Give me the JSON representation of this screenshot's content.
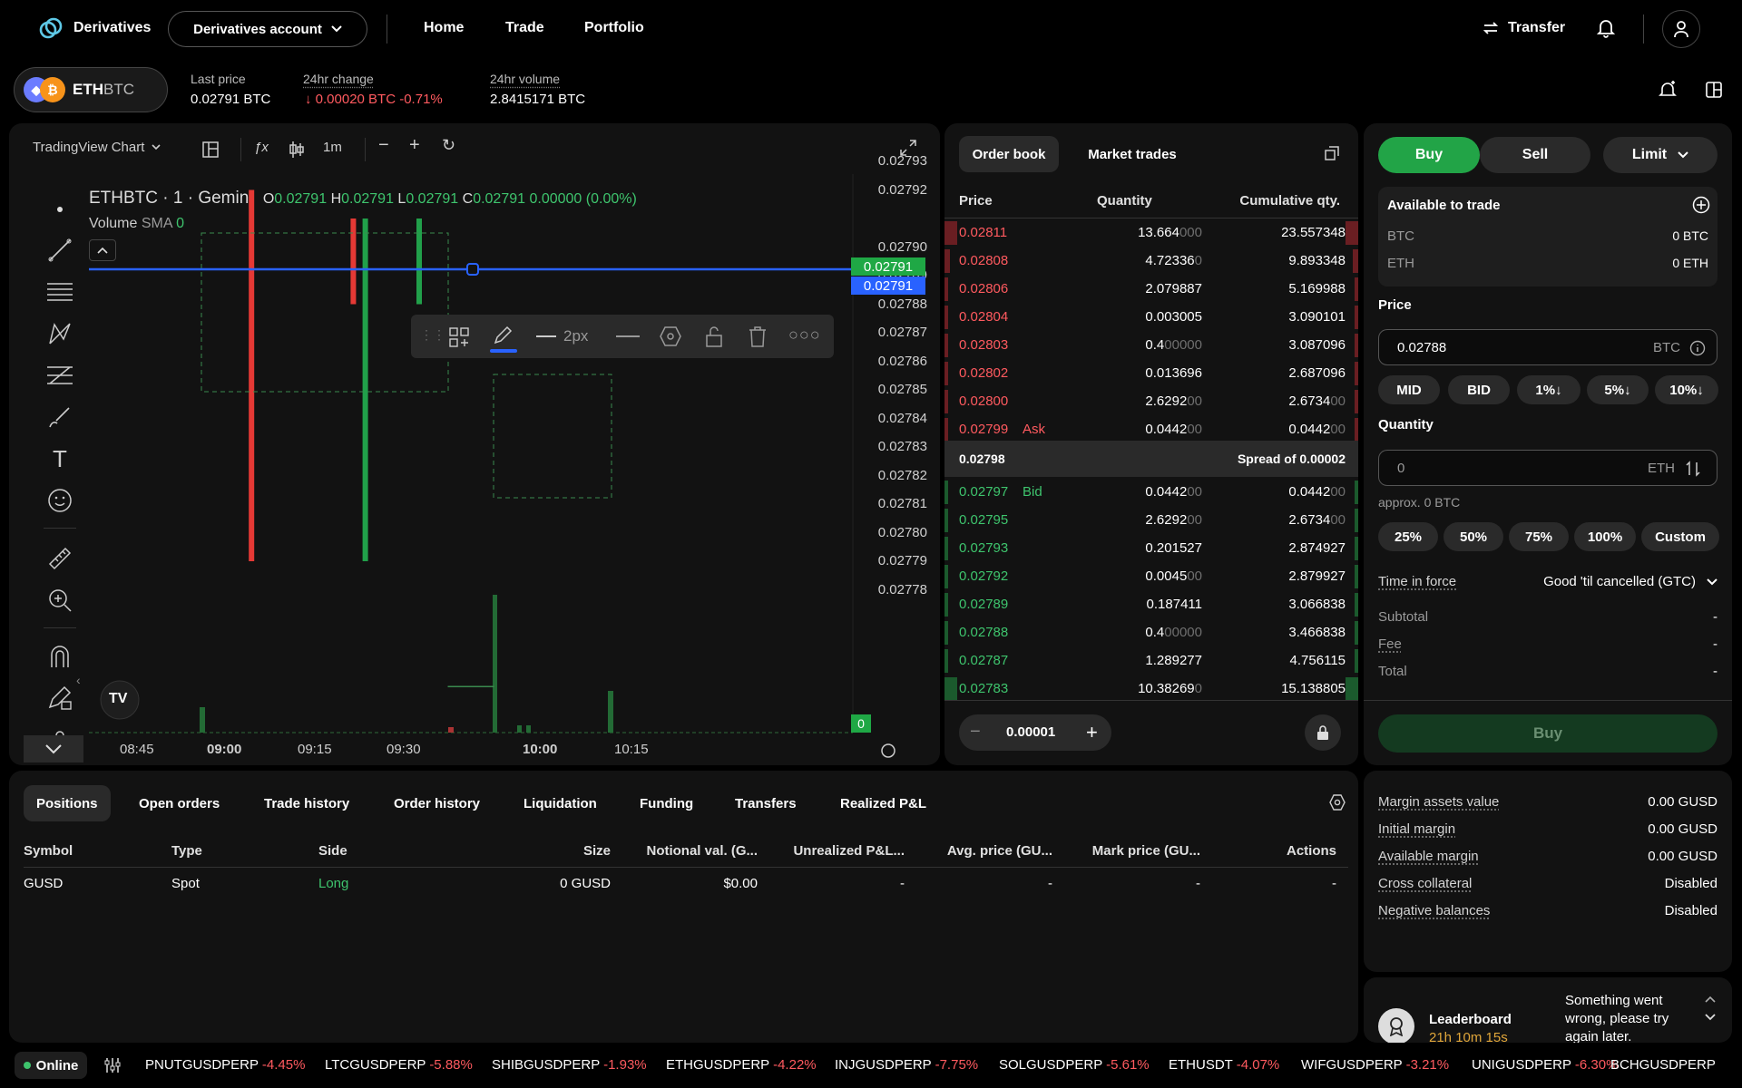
{
  "colors": {
    "accent_green": "#22a447",
    "red": "#ff5a5f",
    "blue": "#2962ff",
    "panel": "#121212"
  },
  "nav": {
    "brand": "Derivatives",
    "account_label": "Derivatives account",
    "links": [
      "Home",
      "Trade",
      "Portfolio"
    ],
    "transfer_label": "Transfer"
  },
  "market": {
    "pair_base": "ETH",
    "pair_quote": "BTC",
    "last_price_label": "Last price",
    "last_price": "0.02791 BTC",
    "change_label": "24hr change",
    "change_value": "↓ 0.00020 BTC -0.71%",
    "volume_label": "24hr volume",
    "volume_value": "2.8415171 BTC"
  },
  "chart": {
    "toolbar_label": "TradingView Chart",
    "interval": "1m",
    "legend_symbol": "ETHBTC · 1 · Gemini",
    "ohlc": {
      "o_label": "O",
      "o": "0.02791",
      "h_label": "H",
      "h": "0.02791",
      "l_label": "L",
      "l": "0.02791",
      "c_label": "C",
      "c": "0.02791",
      "change": "0.00000 (0.00%)"
    },
    "volume_label": "Volume",
    "sma_label": "SMA",
    "sma_value": "0",
    "line_width_label": "2px",
    "price_ticks": [
      "0.02793",
      "0.02792",
      "0.02790",
      "0.02789",
      "0.02788",
      "0.02787",
      "0.02786",
      "0.02785",
      "0.02784",
      "0.02783",
      "0.02782",
      "0.02781",
      "0.02780",
      "0.02779",
      "0.02778"
    ],
    "current_price_tag": "0.02791",
    "line_price_tag": "0.02791",
    "volume_tag": "0",
    "time_ticks": [
      "08:45",
      "09:00",
      "09:15",
      "09:30",
      "10:00",
      "10:15"
    ],
    "tv_logo": "TV"
  },
  "chart_data": {
    "type": "candlestick",
    "ylim": [
      0.02778,
      0.02793
    ],
    "candles": [
      {
        "t": "09:07",
        "o": 0.02792,
        "h": 0.02792,
        "l": 0.02779,
        "c": 0.02779,
        "dir": "down"
      },
      {
        "t": "09:24",
        "o": 0.02791,
        "h": 0.02791,
        "l": 0.02788,
        "c": 0.02788,
        "dir": "down"
      },
      {
        "t": "09:26",
        "o": 0.02779,
        "h": 0.02791,
        "l": 0.02779,
        "c": 0.02791,
        "dir": "up"
      },
      {
        "t": "09:35",
        "o": 0.02788,
        "h": 0.02792,
        "l": 0.02788,
        "c": 0.02791,
        "dir": "up"
      }
    ]
  },
  "orderbook": {
    "tab_book": "Order book",
    "tab_trades": "Market trades",
    "headers": [
      "Price",
      "Quantity",
      "Cumulative qty."
    ],
    "asks": [
      {
        "price": "0.02811",
        "qty": "13.664",
        "qty_dim": "000",
        "cum": "23.557348",
        "cum_dim": "",
        "depth": 1.0
      },
      {
        "price": "0.02808",
        "qty": "4.72336",
        "qty_dim": "0",
        "cum": "9.893348",
        "cum_dim": "",
        "depth": 0.42
      },
      {
        "price": "0.02806",
        "qty": "2.079887",
        "qty_dim": "",
        "cum": "5.169988",
        "cum_dim": "",
        "depth": 0.22
      },
      {
        "price": "0.02804",
        "qty": "0.003005",
        "qty_dim": "",
        "cum": "3.090101",
        "cum_dim": "",
        "depth": 0.13
      },
      {
        "price": "0.02803",
        "qty": "0.4",
        "qty_dim": "00000",
        "cum": "3.087096",
        "cum_dim": "",
        "depth": 0.13
      },
      {
        "price": "0.02802",
        "qty": "0.013696",
        "qty_dim": "",
        "cum": "2.687096",
        "cum_dim": "",
        "depth": 0.11
      },
      {
        "price": "0.02800",
        "qty": "2.6292",
        "qty_dim": "00",
        "cum": "2.6734",
        "cum_dim": "00",
        "depth": 0.11
      },
      {
        "price": "0.02799",
        "qty": "0.0442",
        "qty_dim": "00",
        "cum": "0.0442",
        "cum_dim": "00",
        "depth": 0.02,
        "tag": "Ask"
      }
    ],
    "mid_price": "0.02798",
    "spread_label": "Spread of 0.00002",
    "bids": [
      {
        "price": "0.02797",
        "qty": "0.0442",
        "qty_dim": "00",
        "cum": "0.0442",
        "cum_dim": "00",
        "depth": 0.02,
        "tag": "Bid"
      },
      {
        "price": "0.02795",
        "qty": "2.6292",
        "qty_dim": "00",
        "cum": "2.6734",
        "cum_dim": "00",
        "depth": 0.18
      },
      {
        "price": "0.02793",
        "qty": "0.201527",
        "qty_dim": "",
        "cum": "2.874927",
        "cum_dim": "",
        "depth": 0.19
      },
      {
        "price": "0.02792",
        "qty": "0.0045",
        "qty_dim": "00",
        "cum": "2.879927",
        "cum_dim": "",
        "depth": 0.19
      },
      {
        "price": "0.02789",
        "qty": "0.187411",
        "qty_dim": "",
        "cum": "3.066838",
        "cum_dim": "",
        "depth": 0.2
      },
      {
        "price": "0.02788",
        "qty": "0.4",
        "qty_dim": "00000",
        "cum": "3.466838",
        "cum_dim": "",
        "depth": 0.23
      },
      {
        "price": "0.02787",
        "qty": "1.289277",
        "qty_dim": "",
        "cum": "4.756115",
        "cum_dim": "",
        "depth": 0.31
      },
      {
        "price": "0.02783",
        "qty": "10.38269",
        "qty_dim": "0",
        "cum": "15.138805",
        "cum_dim": "",
        "depth": 1.0
      }
    ],
    "step_value": "0.00001"
  },
  "orderform": {
    "buy_label": "Buy",
    "sell_label": "Sell",
    "type_label": "Limit",
    "available_label": "Available to trade",
    "balances": [
      {
        "asset": "BTC",
        "value": "0 BTC"
      },
      {
        "asset": "ETH",
        "value": "0 ETH"
      }
    ],
    "price_label": "Price",
    "price_value": "0.02788",
    "price_unit": "BTC",
    "price_chips": [
      "MID",
      "BID",
      "1%↓",
      "5%↓",
      "10%↓"
    ],
    "quantity_label": "Quantity",
    "quantity_placeholder": "0",
    "quantity_unit": "ETH",
    "approx": "approx. 0 BTC",
    "qty_chips": [
      "25%",
      "50%",
      "75%",
      "100%",
      "Custom"
    ],
    "tif_label": "Time in force",
    "tif_value": "Good 'til cancelled (GTC)",
    "subtotal_label": "Subtotal",
    "subtotal_value": "-",
    "fee_label": "Fee",
    "fee_value": "-",
    "total_label": "Total",
    "total_value": "-",
    "submit_label": "Buy"
  },
  "positions": {
    "tabs": [
      "Positions",
      "Open orders",
      "Trade history",
      "Order history",
      "Liquidation",
      "Funding",
      "Transfers",
      "Realized P&L"
    ],
    "headers": [
      "Symbol",
      "Type",
      "Side",
      "Size",
      "Notional val. (G...",
      "Unrealized P&L...",
      "Avg. price (GU...",
      "Mark price (GU...",
      "Actions"
    ],
    "rows": [
      [
        "GUSD",
        "Spot",
        "Long",
        "0 GUSD",
        "$0.00",
        "-",
        "-",
        "-",
        "-"
      ]
    ]
  },
  "margin": {
    "items": [
      {
        "label": "Margin assets value",
        "value": "0.00 GUSD"
      },
      {
        "label": "Initial margin",
        "value": "0.00 GUSD"
      },
      {
        "label": "Available margin",
        "value": "0.00 GUSD"
      },
      {
        "label": "Cross collateral",
        "value": "Disabled"
      },
      {
        "label": "Negative balances",
        "value": "Disabled"
      }
    ]
  },
  "leaderboard": {
    "title": "Leaderboard",
    "countdown": "21h 10m 15s",
    "error": "Something went wrong, please try again later."
  },
  "ticker": {
    "status": "Online",
    "items": [
      {
        "sym": "PNUTGUSDPERP",
        "chg": "-4.45%"
      },
      {
        "sym": "LTCGUSDPERP",
        "chg": "-5.88%"
      },
      {
        "sym": "SHIBGUSDPERP",
        "chg": "-1.93%"
      },
      {
        "sym": "ETHGUSDPERP",
        "chg": "-4.22%"
      },
      {
        "sym": "INJGUSDPERP",
        "chg": "-7.75%"
      },
      {
        "sym": "SOLGUSDPERP",
        "chg": "-5.61%"
      },
      {
        "sym": "ETHUSDT",
        "chg": "-4.07%"
      },
      {
        "sym": "WIFGUSDPERP",
        "chg": "-3.21%"
      },
      {
        "sym": "UNIGUSDPERP",
        "chg": "-6.30%"
      },
      {
        "sym": "BCHGUSDPERP",
        "chg": ""
      }
    ]
  }
}
